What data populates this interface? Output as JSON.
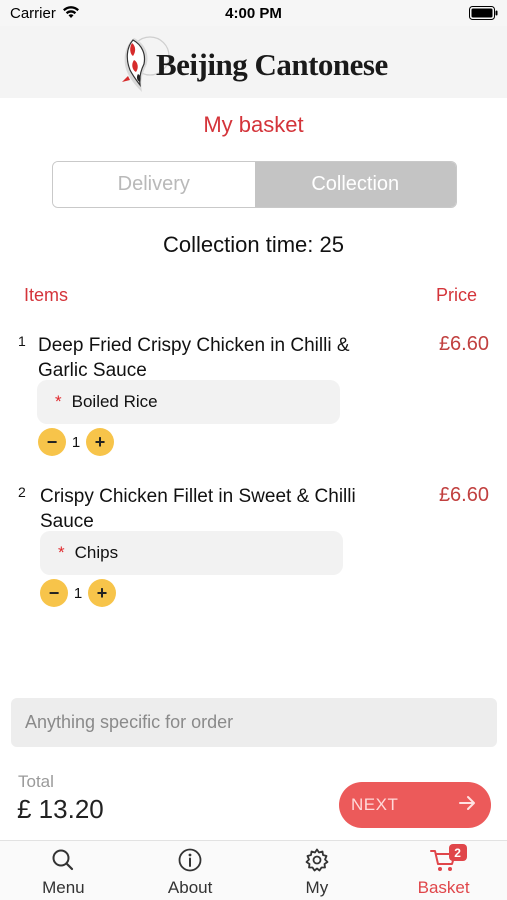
{
  "status_bar": {
    "carrier": "Carrier",
    "time": "4:00 PM"
  },
  "header": {
    "brand": "Beijing Cantonese"
  },
  "page": {
    "title": "My basket"
  },
  "order_type": {
    "delivery_label": "Delivery",
    "collection_label": "Collection",
    "selected": "Collection"
  },
  "collection_time": "Collection time: 25",
  "columns": {
    "items": "Items",
    "price": "Price"
  },
  "items": [
    {
      "number": "1",
      "name": "Deep Fried Crispy Chicken in Chilli & Garlic Sauce",
      "price": "£6.60",
      "option_marker": "*",
      "option": "Boiled Rice",
      "minus": "−",
      "quantity": "1",
      "plus": "+"
    },
    {
      "number": "2",
      "name": "Crispy Chicken Fillet in Sweet & Chilli Sauce",
      "price": "£6.60",
      "option_marker": "*",
      "option": "Chips",
      "minus": "−",
      "quantity": "1",
      "plus": "+"
    }
  ],
  "notes": {
    "placeholder": "Anything specific for order",
    "value": ""
  },
  "footer": {
    "total_label": "Total",
    "total_amount": "£ 13.20",
    "next_label": "NEXT"
  },
  "tabs": [
    {
      "label": "Menu",
      "icon": "search-icon"
    },
    {
      "label": "About",
      "icon": "info-icon"
    },
    {
      "label": "My",
      "icon": "gear-icon"
    },
    {
      "label": "Basket",
      "icon": "cart-icon",
      "badge": "2",
      "active": true
    }
  ],
  "colors": {
    "accent": "#d4343a",
    "price": "#c1403f",
    "qty_button": "#f7c44a",
    "next_button": "#ec5a5a",
    "segment_selected": "#c4c4c4"
  }
}
